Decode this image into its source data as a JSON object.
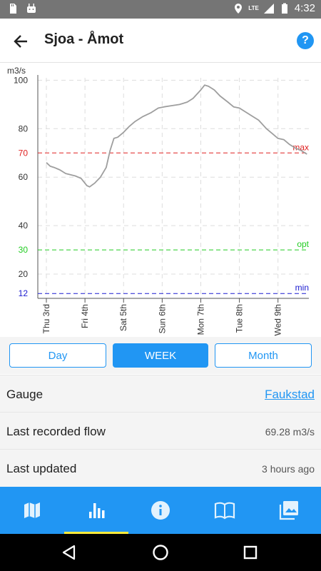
{
  "status_bar": {
    "time": "4:32",
    "network": "LTE",
    "icons": [
      "sd-card-icon",
      "android-icon",
      "location-icon",
      "signal-icon",
      "battery-icon"
    ]
  },
  "app_bar": {
    "title": "Sjoa - Åmot",
    "back_icon": "arrow-back-icon",
    "help_label": "?"
  },
  "chart_data": {
    "type": "line",
    "ylabel": "m3/s",
    "ylim": [
      10,
      101
    ],
    "yticks": [
      12,
      20,
      30,
      40,
      60,
      70,
      80,
      100
    ],
    "ytick_colors": {
      "12": "#1a1ad0",
      "30": "#22cc22",
      "70": "#e02020"
    },
    "x_ticks": [
      "Thu 3rd",
      "Fri 4th",
      "Sat 5th",
      "Sun 6th",
      "Mon 7th",
      "Tue 8th",
      "Wed 9th"
    ],
    "thresholds": [
      {
        "name": "max",
        "value": 70,
        "color": "#e02020"
      },
      {
        "name": "opt",
        "value": 30,
        "color": "#22cc22"
      },
      {
        "name": "min",
        "value": 12,
        "color": "#1a1ad0"
      }
    ],
    "series": [
      {
        "color": "#9e9e9e",
        "points": [
          [
            0.0,
            66.0
          ],
          [
            0.1,
            64.5
          ],
          [
            0.2,
            64.0
          ],
          [
            0.35,
            63.0
          ],
          [
            0.5,
            61.5
          ],
          [
            0.75,
            60.5
          ],
          [
            0.9,
            59.5
          ],
          [
            1.0,
            57.5
          ],
          [
            1.05,
            56.5
          ],
          [
            1.12,
            56.0
          ],
          [
            1.25,
            57.5
          ],
          [
            1.4,
            60.0
          ],
          [
            1.55,
            64.0
          ],
          [
            1.65,
            71.0
          ],
          [
            1.75,
            76.0
          ],
          [
            1.85,
            76.5
          ],
          [
            2.0,
            78.5
          ],
          [
            2.15,
            81.0
          ],
          [
            2.3,
            83.0
          ],
          [
            2.5,
            85.0
          ],
          [
            2.7,
            86.5
          ],
          [
            2.9,
            88.5
          ],
          [
            3.05,
            89.0
          ],
          [
            3.25,
            89.5
          ],
          [
            3.45,
            90.0
          ],
          [
            3.65,
            91.0
          ],
          [
            3.8,
            92.5
          ],
          [
            4.0,
            96.0
          ],
          [
            4.1,
            98.0
          ],
          [
            4.2,
            97.5
          ],
          [
            4.35,
            96.0
          ],
          [
            4.5,
            93.5
          ],
          [
            4.7,
            91.0
          ],
          [
            4.85,
            89.0
          ],
          [
            5.0,
            88.5
          ],
          [
            5.15,
            87.0
          ],
          [
            5.3,
            85.5
          ],
          [
            5.5,
            83.5
          ],
          [
            5.7,
            80.0
          ],
          [
            5.85,
            78.0
          ],
          [
            6.0,
            76.0
          ],
          [
            6.15,
            75.5
          ],
          [
            6.3,
            73.5
          ],
          [
            6.45,
            72.0
          ],
          [
            6.6,
            71.0
          ],
          [
            6.75,
            69.5
          ]
        ]
      }
    ]
  },
  "range_buttons": [
    {
      "label": "Day",
      "active": false
    },
    {
      "label": "WEEK",
      "active": true
    },
    {
      "label": "Month",
      "active": false
    }
  ],
  "info": {
    "gauge_label": "Gauge",
    "gauge_value": "Faukstad",
    "flow_label": "Last recorded flow",
    "flow_value": "69.28 m3/s",
    "updated_label": "Last updated",
    "updated_value": "3 hours ago"
  },
  "bottom_nav": [
    {
      "icon": "map-icon",
      "active": false
    },
    {
      "icon": "bar-chart-icon",
      "active": true
    },
    {
      "icon": "info-icon",
      "active": false
    },
    {
      "icon": "book-icon",
      "active": false
    },
    {
      "icon": "photos-icon",
      "active": false
    }
  ],
  "system_nav": [
    "back-triangle-icon",
    "home-circle-icon",
    "recents-square-icon"
  ],
  "colors": {
    "accent": "#2196F3",
    "active_indicator": "#FFEB3B",
    "status_bar": "#757575"
  }
}
